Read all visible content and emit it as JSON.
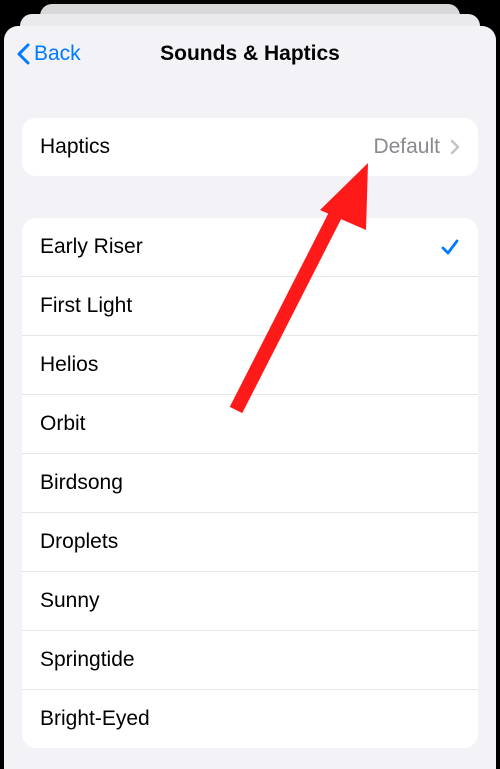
{
  "header": {
    "back_label": "Back",
    "title": "Sounds & Haptics"
  },
  "haptics": {
    "label": "Haptics",
    "value": "Default"
  },
  "sounds": [
    {
      "label": "Early Riser",
      "selected": true
    },
    {
      "label": "First Light",
      "selected": false
    },
    {
      "label": "Helios",
      "selected": false
    },
    {
      "label": "Orbit",
      "selected": false
    },
    {
      "label": "Birdsong",
      "selected": false
    },
    {
      "label": "Droplets",
      "selected": false
    },
    {
      "label": "Sunny",
      "selected": false
    },
    {
      "label": "Springtide",
      "selected": false
    },
    {
      "label": "Bright-Eyed",
      "selected": false
    }
  ]
}
